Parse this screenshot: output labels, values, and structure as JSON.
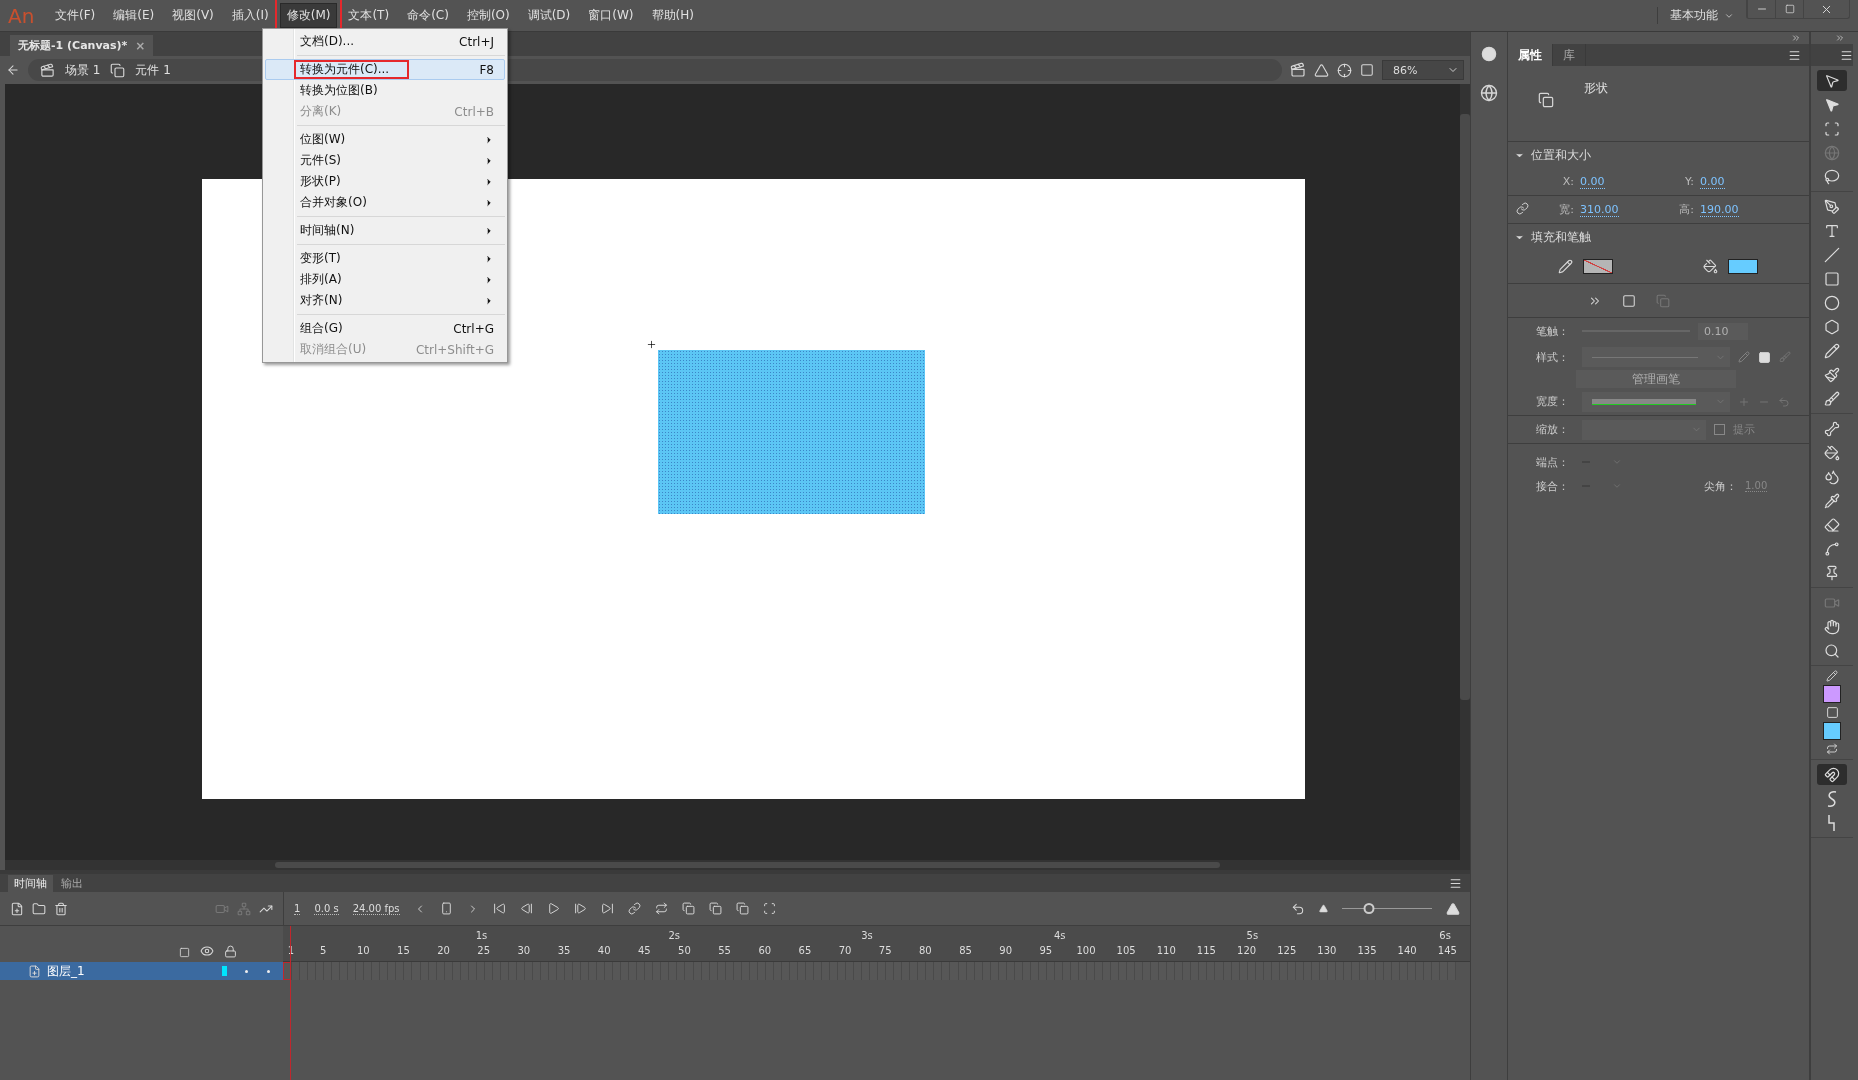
{
  "app": {
    "logo": "An",
    "workspace": "基本功能"
  },
  "menus": [
    {
      "label": "文件(F)",
      "selected": false,
      "outlined": false
    },
    {
      "label": "编辑(E)",
      "selected": false,
      "outlined": false
    },
    {
      "label": "视图(V)",
      "selected": false,
      "outlined": false
    },
    {
      "label": "插入(I)",
      "selected": false,
      "outlined": false
    },
    {
      "label": "修改(M)",
      "selected": true,
      "outlined": true
    },
    {
      "label": "文本(T)",
      "selected": false,
      "outlined": false
    },
    {
      "label": "命令(C)",
      "selected": false,
      "outlined": false
    },
    {
      "label": "控制(O)",
      "selected": false,
      "outlined": false
    },
    {
      "label": "调试(D)",
      "selected": false,
      "outlined": false
    },
    {
      "label": "窗口(W)",
      "selected": false,
      "outlined": false
    },
    {
      "label": "帮助(H)",
      "selected": false,
      "outlined": false
    }
  ],
  "modify_menu": [
    {
      "kind": "item",
      "label": "文档(D)...",
      "shortcut": "Ctrl+J",
      "selected": false,
      "disabled": false,
      "outlined": false,
      "submenu": false
    },
    {
      "kind": "separator"
    },
    {
      "kind": "item",
      "label": "转换为元件(C)...",
      "shortcut": "F8",
      "selected": true,
      "disabled": false,
      "outlined": true,
      "submenu": false
    },
    {
      "kind": "item",
      "label": "转换为位图(B)",
      "selected": false,
      "disabled": false,
      "outlined": false,
      "submenu": false
    },
    {
      "kind": "item",
      "label": "分离(K)",
      "shortcut": "Ctrl+B",
      "selected": false,
      "disabled": true,
      "outlined": false,
      "submenu": false
    },
    {
      "kind": "separator"
    },
    {
      "kind": "item",
      "label": "位图(W)",
      "selected": false,
      "disabled": false,
      "outlined": false,
      "submenu": true
    },
    {
      "kind": "item",
      "label": "元件(S)",
      "selected": false,
      "disabled": false,
      "outlined": false,
      "submenu": true
    },
    {
      "kind": "item",
      "label": "形状(P)",
      "selected": false,
      "disabled": false,
      "outlined": false,
      "submenu": true
    },
    {
      "kind": "item",
      "label": "合并对象(O)",
      "selected": false,
      "disabled": false,
      "outlined": false,
      "submenu": true
    },
    {
      "kind": "separator"
    },
    {
      "kind": "item",
      "label": "时间轴(N)",
      "selected": false,
      "disabled": false,
      "outlined": false,
      "submenu": true
    },
    {
      "kind": "separator"
    },
    {
      "kind": "item",
      "label": "变形(T)",
      "selected": false,
      "disabled": false,
      "outlined": false,
      "submenu": true
    },
    {
      "kind": "item",
      "label": "排列(A)",
      "selected": false,
      "disabled": false,
      "outlined": false,
      "submenu": true
    },
    {
      "kind": "item",
      "label": "对齐(N)",
      "selected": false,
      "disabled": false,
      "outlined": false,
      "submenu": true
    },
    {
      "kind": "separator"
    },
    {
      "kind": "item",
      "label": "组合(G)",
      "shortcut": "Ctrl+G",
      "selected": false,
      "disabled": false,
      "outlined": false,
      "submenu": false
    },
    {
      "kind": "item",
      "label": "取消组合(U)",
      "shortcut": "Ctrl+Shift+G",
      "selected": false,
      "disabled": true,
      "outlined": false,
      "submenu": false
    }
  ],
  "document_tab": {
    "title": "无标题-1 (Canvas)*",
    "close": "×"
  },
  "breadcrumb": [
    "场景 1",
    "元件 1"
  ],
  "zoom": "86%",
  "properties": {
    "tabs": [
      {
        "label": "属性",
        "selected": true
      },
      {
        "label": "库",
        "selected": false
      }
    ],
    "object_type": "形状",
    "position_size": {
      "title": "位置和大小",
      "expanded": true,
      "fields": [
        {
          "label": "X:",
          "value": "0.00"
        },
        {
          "label": "Y:",
          "value": "0.00"
        },
        {
          "label": "宽:",
          "value": "310.00"
        },
        {
          "label": "高:",
          "value": "190.00"
        }
      ]
    },
    "fill_stroke": {
      "title": "填充和笔触",
      "expanded": true,
      "stroke_label": "笔触：",
      "stroke_value": "0.10",
      "style_label": "样式：",
      "brush_button": "管理画笔",
      "width_label": "宽度：",
      "scale_label": "缩放：",
      "hint": {
        "label": "提示",
        "checked": false
      },
      "cap_label": "端点：",
      "join_label": "接合：",
      "miter_label": "尖角：",
      "miter_value": "1.00"
    }
  },
  "tool_groups": [
    {
      "tools": [
        {
          "kind": "selection",
          "selected": true
        },
        {
          "kind": "subselection",
          "selected": false
        },
        {
          "kind": "transform",
          "selected": false
        },
        {
          "kind": "rotate",
          "selected": false
        },
        {
          "kind": "lasso",
          "selected": false
        }
      ]
    },
    {
      "tools": [
        {
          "kind": "pen",
          "selected": false
        },
        {
          "kind": "text",
          "selected": false
        },
        {
          "kind": "line",
          "selected": false
        },
        {
          "kind": "rectangle",
          "selected": false
        },
        {
          "kind": "oval",
          "selected": false
        },
        {
          "kind": "polystar",
          "selected": false
        },
        {
          "kind": "pencil",
          "selected": false
        },
        {
          "kind": "paintbrush",
          "selected": false
        },
        {
          "kind": "brush",
          "selected": false
        }
      ]
    },
    {
      "tools": [
        {
          "kind": "bone",
          "selected": false
        },
        {
          "kind": "bucket",
          "selected": false
        },
        {
          "kind": "inkbottle",
          "selected": false
        },
        {
          "kind": "eyedropper",
          "selected": false
        },
        {
          "kind": "eraser",
          "selected": false
        },
        {
          "kind": "width",
          "selected": false
        },
        {
          "kind": "pin",
          "selected": false
        }
      ]
    },
    {
      "tools": [
        {
          "kind": "camera",
          "selected": false
        },
        {
          "kind": "hand",
          "selected": false
        },
        {
          "kind": "zoom",
          "selected": false
        }
      ]
    }
  ],
  "snap_tools": [
    {
      "kind": "magnet",
      "selected": true
    },
    {
      "kind": "smooth",
      "selected": false
    },
    {
      "kind": "straighten",
      "selected": false
    }
  ],
  "timeline": {
    "tabs": [
      {
        "label": "时间轴",
        "selected": true
      },
      {
        "label": "输出",
        "selected": false
      }
    ],
    "frame": "1",
    "time": "0.0 s",
    "fps": "24.00 fps",
    "zoom": {
      "level": 0.3
    },
    "seconds": [
      "1s",
      "2s",
      "3s",
      "4s",
      "5s",
      "6s"
    ],
    "frames": [
      "1",
      "5",
      "10",
      "15",
      "20",
      "25",
      "30",
      "35",
      "40",
      "45",
      "50",
      "55",
      "60",
      "65",
      "70",
      "75",
      "80",
      "85",
      "90",
      "95",
      "100",
      "105",
      "110",
      "115",
      "120",
      "125",
      "130",
      "135",
      "140",
      "145"
    ],
    "layers": [
      {
        "name": "图层_1",
        "selected": true,
        "color": "#00e5ff"
      }
    ]
  }
}
